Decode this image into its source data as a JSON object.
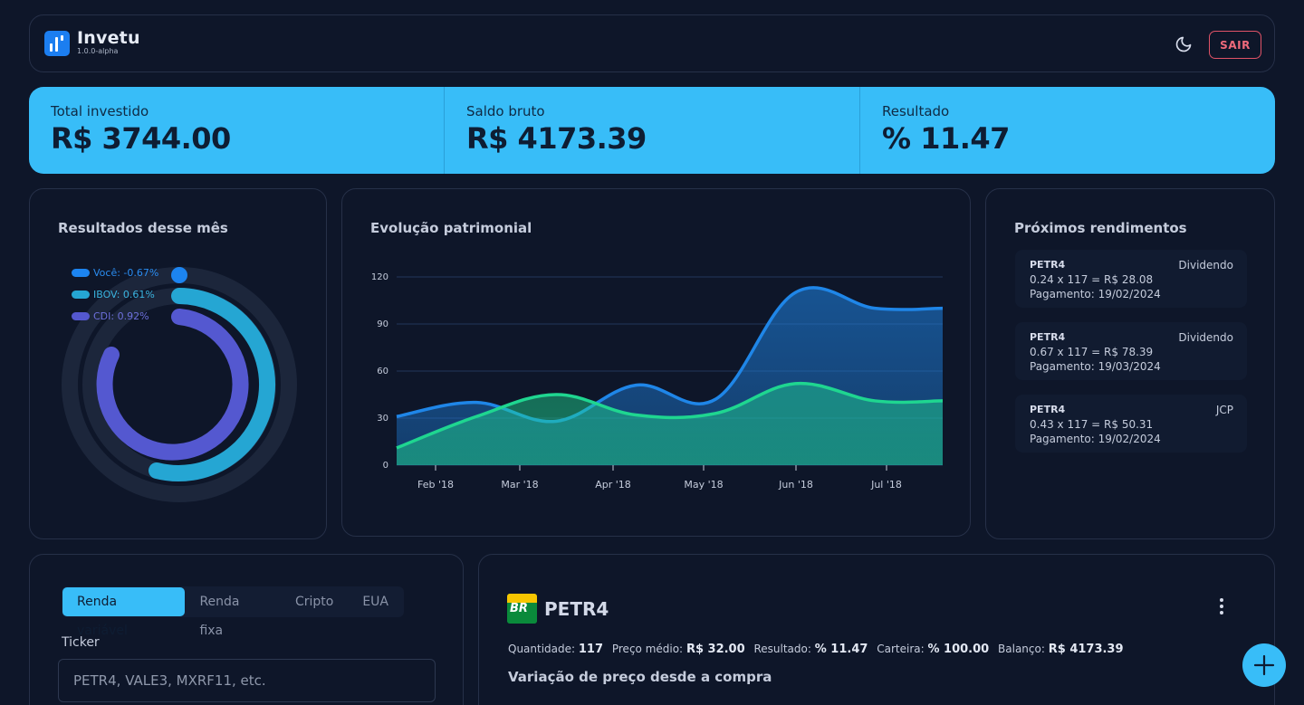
{
  "header": {
    "brand": "Invetu",
    "version": "1.0.0-alpha",
    "theme_icon": "moon-icon",
    "logout_label": "SAIR"
  },
  "summary": {
    "total_label": "Total investido",
    "total_value": "R$ 3744.00",
    "saldo_label": "Saldo bruto",
    "saldo_value": "R$ 4173.39",
    "resultado_label": "Resultado",
    "resultado_value": "% 11.47"
  },
  "month_results": {
    "title": "Resultados desse mês",
    "items": [
      {
        "label": "Você: -0.67%",
        "color": "#1c84f0",
        "value": -0.67
      },
      {
        "label": "IBOV: 0.61%",
        "color": "#25a6d3",
        "value": 0.61
      },
      {
        "label": "CDI: 0.92%",
        "color": "#5458d0",
        "value": 0.92
      }
    ]
  },
  "chart_data": {
    "type": "area",
    "title": "Evolução patrimonial",
    "x_ticks": [
      "Feb '18",
      "Mar '18",
      "Apr '18",
      "May '18",
      "Jun '18",
      "Jul '18"
    ],
    "ylim": [
      0,
      120
    ],
    "y_ticks": [
      "120",
      "90",
      "60",
      "30",
      "0"
    ],
    "series": [
      {
        "color": "#1f86e8",
        "x": [
          0,
          1,
          2,
          3,
          4,
          5,
          6,
          7
        ],
        "values": [
          31,
          40,
          28,
          51,
          42,
          110,
          100,
          100
        ]
      },
      {
        "color": "#1fd690",
        "x": [
          0,
          1,
          2,
          3,
          4,
          5,
          6,
          7
        ],
        "values": [
          11,
          31,
          45,
          32,
          33,
          52,
          41,
          41
        ]
      }
    ]
  },
  "rendimentos": {
    "title": "Próximos rendimentos",
    "items": [
      {
        "ticker": "PETR4",
        "type": "Dividendo",
        "calc": "0.24 x 117 = R$ 28.08",
        "payment": "Pagamento: 19/02/2024"
      },
      {
        "ticker": "PETR4",
        "type": "Dividendo",
        "calc": "0.67 x 117 = R$ 78.39",
        "payment": "Pagamento: 19/03/2024"
      },
      {
        "ticker": "PETR4",
        "type": "JCP",
        "calc": "0.43 x 117 = R$ 50.31",
        "payment": "Pagamento: 19/02/2024"
      }
    ]
  },
  "form": {
    "tabs": [
      "Renda variável",
      "Renda fixa",
      "Cripto",
      "EUA"
    ],
    "active_tab": 0,
    "ticker_label": "Ticker",
    "ticker_placeholder": "PETR4, VALE3, MXRF11, etc."
  },
  "asset": {
    "logo_text": "BR",
    "name": "PETR4",
    "quantidade_label": "Quantidade:",
    "quantidade_value": "117",
    "preco_label": "Preço médio:",
    "preco_value": "R$ 32.00",
    "resultado_label": "Resultado:",
    "resultado_value": "% 11.47",
    "carteira_label": "Carteira:",
    "carteira_value": "% 100.00",
    "balanco_label": "Balanço:",
    "balanco_value": "R$ 4173.39",
    "variacao_title": "Variação de preço desde a compra"
  },
  "fab_icon": "plus-icon"
}
